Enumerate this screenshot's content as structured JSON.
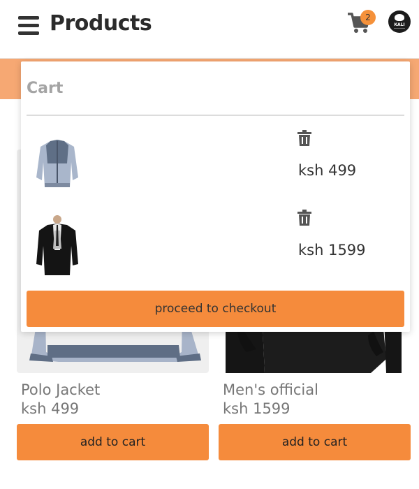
{
  "header": {
    "title": "Products",
    "cart_count": "2",
    "logo_text": "KALI",
    "menu_icon": "hamburger-menu-icon",
    "cart_icon": "shopping-cart-icon"
  },
  "background": {
    "banner_color": "#f6a873"
  },
  "cart": {
    "title": "Cart",
    "items": [
      {
        "image": "grey-fleece-jacket",
        "price": "ksh 499"
      },
      {
        "image": "black-suit",
        "price": "ksh 1599"
      }
    ],
    "remove_icon": "trash-icon",
    "checkout_label": "proceed to checkout"
  },
  "products": [
    {
      "name": "Polo Jacket",
      "price": "ksh 499",
      "button": "add to cart"
    },
    {
      "name": "Men's official",
      "price": "ksh 1599",
      "button": "add to cart"
    }
  ],
  "colors": {
    "accent": "#f58b3c",
    "badge": "#f5913a"
  }
}
